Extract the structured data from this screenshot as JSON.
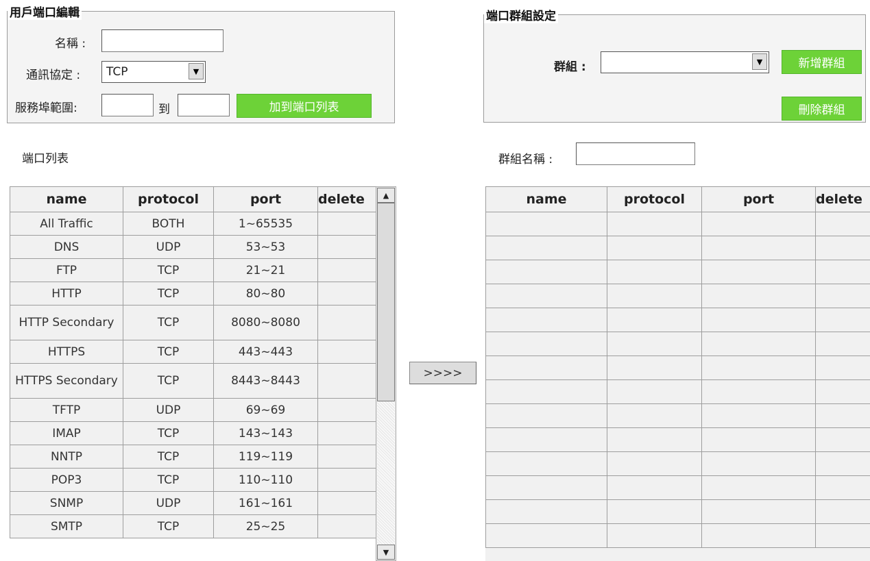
{
  "port_edit": {
    "legend": "用戶端口編輯",
    "name_label": "名稱 :",
    "name_value": "",
    "protocol_label": "通訊協定 :",
    "protocol_value": "TCP",
    "range_label": "服務埠範圍:",
    "range_from": "",
    "range_to_label": "到",
    "range_to": "",
    "add_button": "加到端口列表"
  },
  "group_settings": {
    "legend": "端口群組設定",
    "group_label": "群組 :",
    "group_value": "",
    "new_button": "新增群組",
    "delete_button": "刪除群組"
  },
  "port_list": {
    "title": "端口列表",
    "columns": [
      "name",
      "protocol",
      "port",
      "delete"
    ],
    "rows": [
      {
        "name": "All Traffic",
        "protocol": "BOTH",
        "port": "1~65535"
      },
      {
        "name": "DNS",
        "protocol": "UDP",
        "port": "53~53"
      },
      {
        "name": "FTP",
        "protocol": "TCP",
        "port": "21~21"
      },
      {
        "name": "HTTP",
        "protocol": "TCP",
        "port": "80~80"
      },
      {
        "name": "HTTP Secondary",
        "protocol": "TCP",
        "port": "8080~8080"
      },
      {
        "name": "HTTPS",
        "protocol": "TCP",
        "port": "443~443"
      },
      {
        "name": "HTTPS Secondary",
        "protocol": "TCP",
        "port": "8443~8443"
      },
      {
        "name": "TFTP",
        "protocol": "UDP",
        "port": "69~69"
      },
      {
        "name": "IMAP",
        "protocol": "TCP",
        "port": "143~143"
      },
      {
        "name": "NNTP",
        "protocol": "TCP",
        "port": "119~119"
      },
      {
        "name": "POP3",
        "protocol": "TCP",
        "port": "110~110"
      },
      {
        "name": "SNMP",
        "protocol": "UDP",
        "port": "161~161"
      },
      {
        "name": "SMTP",
        "protocol": "TCP",
        "port": "25~25"
      }
    ]
  },
  "transfer_button": ">>>>",
  "group_table": {
    "name_label": "群組名稱 :",
    "name_value": "",
    "columns": [
      "name",
      "protocol",
      "port",
      "delete"
    ],
    "empty_rows": 14
  },
  "colors": {
    "accent_green": "#6dd238",
    "panel_gray": "#f4f4f4"
  }
}
